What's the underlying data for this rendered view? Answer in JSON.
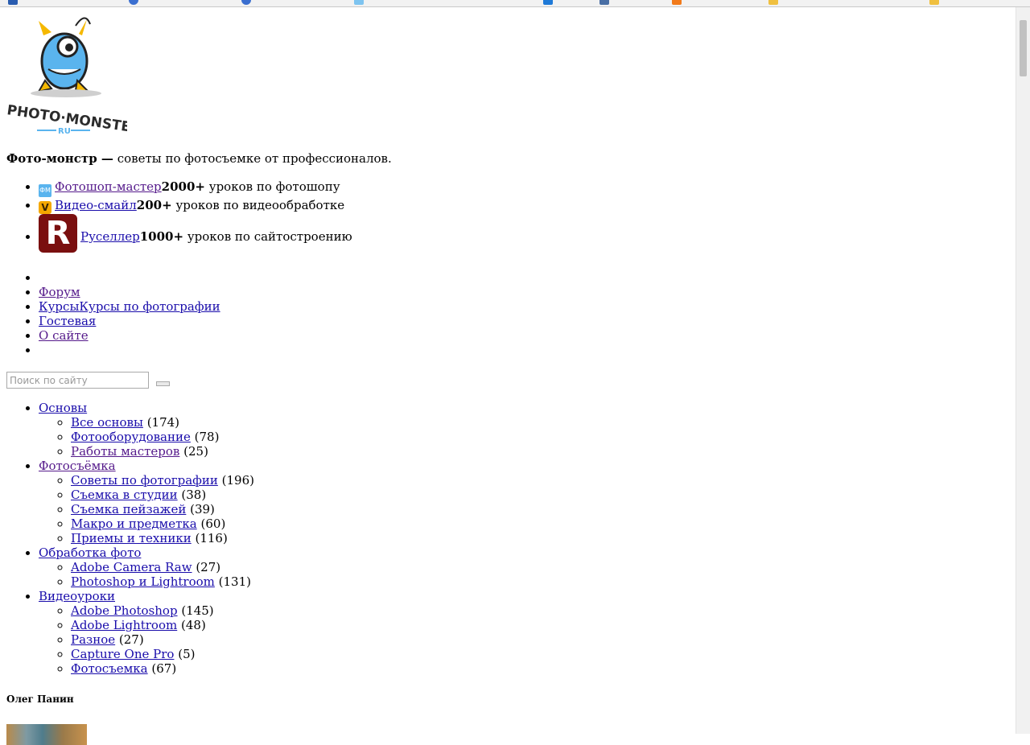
{
  "tagline": {
    "brand": "Фото-монстр —",
    "rest": " советы по фотосъемке от профессионалов."
  },
  "logo": {
    "name": "PHOTO·MONSTER",
    "sub": "RU"
  },
  "projects": [
    {
      "icon": "fotoshop-master-icon",
      "link": "Фотошоп-мастер",
      "count": "2000+",
      "text": " уроков по фотошопу"
    },
    {
      "icon": "video-smile-icon",
      "link": "Видео-смайл",
      "count": "200+",
      "text": " уроков по видеообработке"
    },
    {
      "icon": "ruseller-icon",
      "icon_letter": "R",
      "link": "Руселлер",
      "count": "1000+",
      "text": " уроков по сайтостроению"
    }
  ],
  "menu": {
    "forum": "Форум",
    "courses_a": "Курсы",
    "courses_b": "Курсы по фотографии",
    "guestbook": "Гостевая",
    "about": "О сайте"
  },
  "search": {
    "placeholder": "Поиск по сайту"
  },
  "categories": [
    {
      "name": "Основы",
      "children": [
        {
          "name": "Все основы",
          "count": "(174)"
        },
        {
          "name": "Фотооборудование",
          "count": "(78)"
        },
        {
          "name": "Работы мастеров",
          "count": "(25)"
        }
      ]
    },
    {
      "name": "Фотосъёмка",
      "children": [
        {
          "name": "Советы по фотографии",
          "count": "(196)"
        },
        {
          "name": "Съемка в студии",
          "count": "(38)"
        },
        {
          "name": "Съемка пейзажей",
          "count": "(39)"
        },
        {
          "name": "Макро и предметка",
          "count": "(60)"
        },
        {
          "name": "Приемы и техники",
          "count": "(116)"
        }
      ]
    },
    {
      "name": "Обработка фото",
      "children": [
        {
          "name": "Adobe Camera Raw",
          "count": "(27)"
        },
        {
          "name": "Photoshop и Lightroom",
          "count": "(131)"
        }
      ]
    },
    {
      "name": "Видеоуроки",
      "children": [
        {
          "name": "Adobe Photoshop",
          "count": "(145)"
        },
        {
          "name": "Adobe Lightroom",
          "count": "(48)"
        },
        {
          "name": "Разное",
          "count": "(27)"
        },
        {
          "name": "Capture One Pro",
          "count": "(5)"
        },
        {
          "name": "Фотосъемка",
          "count": "(67)"
        }
      ]
    }
  ],
  "author": {
    "name": "Олег Панин"
  },
  "colors": {
    "link": "#1a0dab",
    "visited": "#551a8b",
    "monster_blue": "#5ab4ee",
    "monster_yellow": "#f5b800",
    "ruseller": "#7a0f0f"
  }
}
